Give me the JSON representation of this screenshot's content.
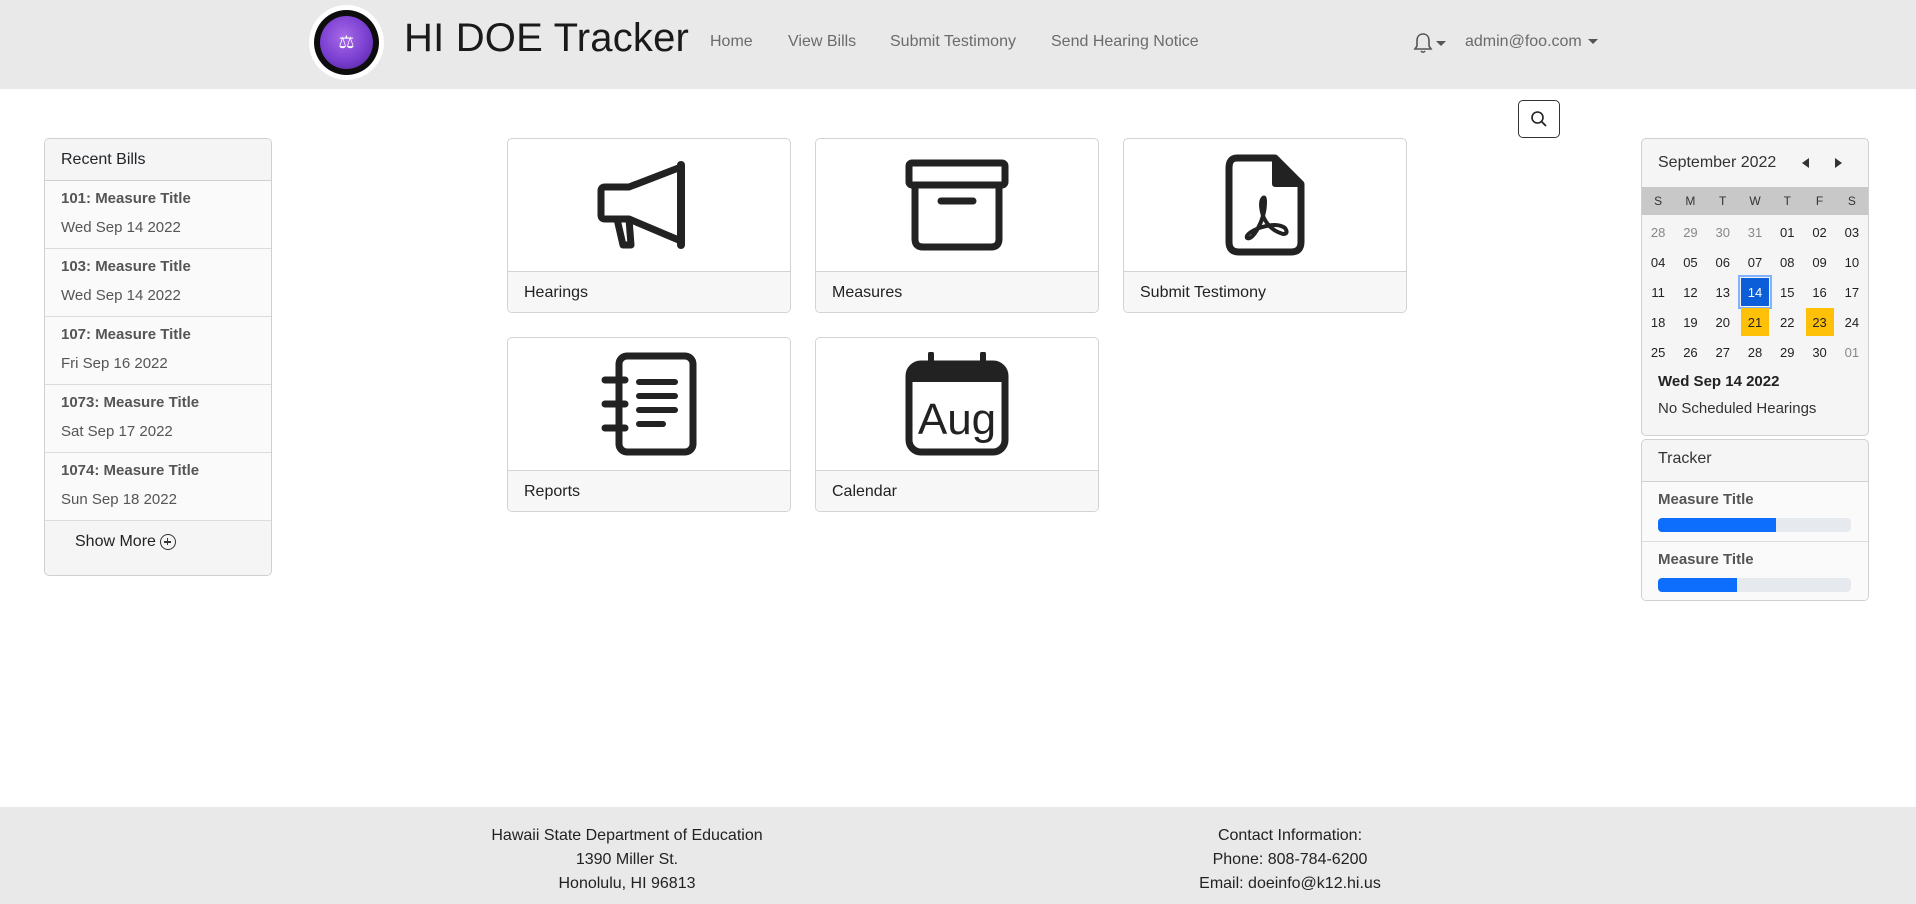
{
  "nav": {
    "brand": "HI DOE Tracker",
    "links": [
      "Home",
      "View Bills",
      "Submit Testimony",
      "Send Hearing Notice"
    ],
    "user": "admin@foo.com"
  },
  "recent_bills": {
    "header": "Recent Bills",
    "items": [
      {
        "title": "101: Measure Title",
        "date": "Wed Sep 14 2022"
      },
      {
        "title": "103: Measure Title",
        "date": "Wed Sep 14 2022"
      },
      {
        "title": "107: Measure Title",
        "date": "Fri Sep 16 2022"
      },
      {
        "title": "1073: Measure Title",
        "date": "Sat Sep 17 2022"
      },
      {
        "title": "1074: Measure Title",
        "date": "Sun Sep 18 2022"
      }
    ],
    "show_more": "Show More"
  },
  "tiles": [
    {
      "label": "Hearings",
      "icon": "megaphone-icon"
    },
    {
      "label": "Measures",
      "icon": "archive-box-icon"
    },
    {
      "label": "Submit Testimony",
      "icon": "pdf-file-icon"
    },
    {
      "label": "Reports",
      "icon": "journal-list-icon"
    },
    {
      "label": "Calendar",
      "icon": "calendar-aug-icon",
      "icon_text": "Aug"
    }
  ],
  "calendar": {
    "month": "September 2022",
    "dow": [
      "S",
      "M",
      "T",
      "W",
      "T",
      "F",
      "S"
    ],
    "days": [
      {
        "d": "28",
        "muted": true
      },
      {
        "d": "29",
        "muted": true
      },
      {
        "d": "30",
        "muted": true
      },
      {
        "d": "31",
        "muted": true
      },
      {
        "d": "01"
      },
      {
        "d": "02"
      },
      {
        "d": "03"
      },
      {
        "d": "04"
      },
      {
        "d": "05"
      },
      {
        "d": "06"
      },
      {
        "d": "07"
      },
      {
        "d": "08"
      },
      {
        "d": "09"
      },
      {
        "d": "10"
      },
      {
        "d": "11"
      },
      {
        "d": "12"
      },
      {
        "d": "13"
      },
      {
        "d": "14",
        "today": true
      },
      {
        "d": "15"
      },
      {
        "d": "16"
      },
      {
        "d": "17"
      },
      {
        "d": "18"
      },
      {
        "d": "19"
      },
      {
        "d": "20"
      },
      {
        "d": "21",
        "event": true
      },
      {
        "d": "22"
      },
      {
        "d": "23",
        "event": true
      },
      {
        "d": "24"
      },
      {
        "d": "25"
      },
      {
        "d": "26"
      },
      {
        "d": "27"
      },
      {
        "d": "28"
      },
      {
        "d": "29"
      },
      {
        "d": "30"
      },
      {
        "d": "01",
        "muted": true
      }
    ],
    "selected_date": "Wed Sep 14 2022",
    "note": "No Scheduled Hearings",
    "today_color": "#0b5ed7",
    "event_color": "#ffc107"
  },
  "tracker": {
    "header": "Tracker",
    "items": [
      {
        "title": "Measure Title",
        "progress": 0.61
      },
      {
        "title": "Measure Title",
        "progress": 0.41
      }
    ],
    "bar_color": "#0d6efd"
  },
  "footer": {
    "left": [
      "Hawaii State Department of Education",
      "1390 Miller St.",
      "Honolulu, HI 96813"
    ],
    "right": [
      "Contact Information:",
      "Phone: 808-784-6200",
      "Email: doeinfo@k12.hi.us"
    ]
  }
}
